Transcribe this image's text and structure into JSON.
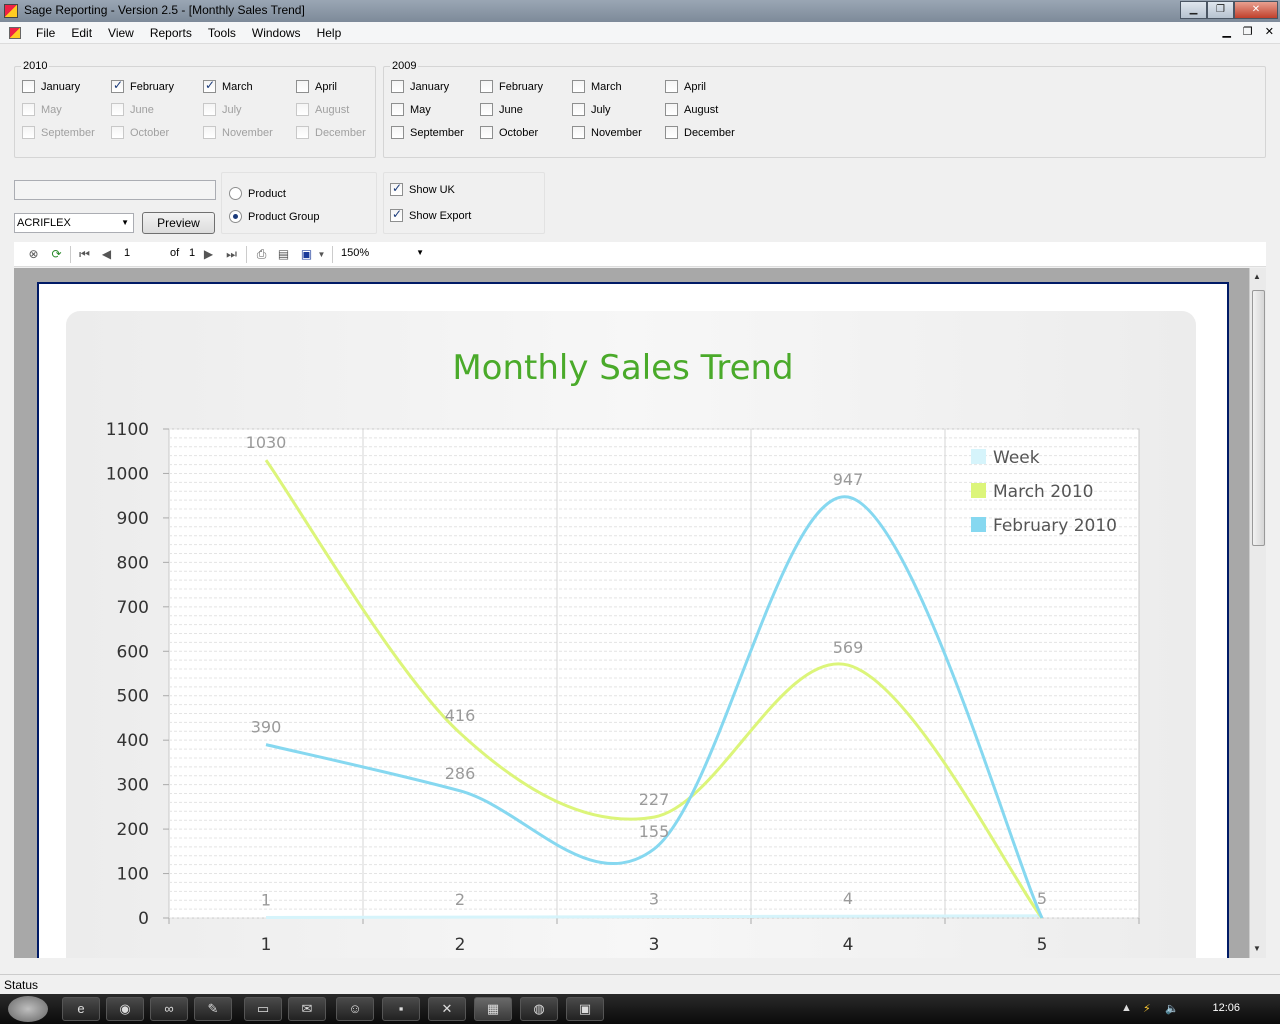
{
  "window": {
    "title": "Sage Reporting - Version 2.5 - [Monthly Sales Trend]"
  },
  "menu": [
    "File",
    "Edit",
    "View",
    "Reports",
    "Tools",
    "Windows",
    "Help"
  ],
  "year2010": {
    "label": "2010",
    "months": [
      {
        "label": "January",
        "checked": false,
        "disabled": false
      },
      {
        "label": "February",
        "checked": true,
        "disabled": false
      },
      {
        "label": "March",
        "checked": true,
        "disabled": false
      },
      {
        "label": "April",
        "checked": false,
        "disabled": false
      },
      {
        "label": "May",
        "checked": false,
        "disabled": true
      },
      {
        "label": "June",
        "checked": false,
        "disabled": true
      },
      {
        "label": "July",
        "checked": false,
        "disabled": true
      },
      {
        "label": "August",
        "checked": false,
        "disabled": true
      },
      {
        "label": "September",
        "checked": false,
        "disabled": true
      },
      {
        "label": "October",
        "checked": false,
        "disabled": true
      },
      {
        "label": "November",
        "checked": false,
        "disabled": true
      },
      {
        "label": "December",
        "checked": false,
        "disabled": true
      }
    ]
  },
  "year2009": {
    "label": "2009",
    "months": [
      {
        "label": "January",
        "checked": false,
        "disabled": false
      },
      {
        "label": "February",
        "checked": false,
        "disabled": false
      },
      {
        "label": "March",
        "checked": false,
        "disabled": false
      },
      {
        "label": "April",
        "checked": false,
        "disabled": false
      },
      {
        "label": "May",
        "checked": false,
        "disabled": false
      },
      {
        "label": "June",
        "checked": false,
        "disabled": false
      },
      {
        "label": "July",
        "checked": false,
        "disabled": false
      },
      {
        "label": "August",
        "checked": false,
        "disabled": false
      },
      {
        "label": "September",
        "checked": false,
        "disabled": false
      },
      {
        "label": "October",
        "checked": false,
        "disabled": false
      },
      {
        "label": "November",
        "checked": false,
        "disabled": false
      },
      {
        "label": "December",
        "checked": false,
        "disabled": false
      }
    ]
  },
  "filter": {
    "search_value": "",
    "combo_value": "ACRIFLEX",
    "preview_label": "Preview",
    "radio": [
      {
        "label": "Product",
        "selected": false
      },
      {
        "label": "Product Group",
        "selected": true
      }
    ],
    "show_uk": {
      "label": "Show UK",
      "checked": true
    },
    "show_export": {
      "label": "Show Export",
      "checked": true
    }
  },
  "toolbar": {
    "page": "1",
    "of_label": "of",
    "total_pages": "1",
    "zoom": "150%"
  },
  "chart_data": {
    "type": "line",
    "title": "Monthly Sales Trend",
    "title_color": "#4aaa2a",
    "categories": [
      1,
      2,
      3,
      4,
      5
    ],
    "ylim": [
      0,
      1100
    ],
    "yticks": [
      0,
      100,
      200,
      300,
      400,
      500,
      600,
      700,
      800,
      900,
      1000,
      1100
    ],
    "grid": true,
    "legend_position": "top-right",
    "series": [
      {
        "name": "Week",
        "color": "#d6f4fb",
        "values": [
          1,
          2,
          3,
          4,
          5
        ],
        "labels": [
          "1",
          "2",
          "3",
          "4",
          "5"
        ]
      },
      {
        "name": "March 2010",
        "color": "#dcf57a",
        "values": [
          1030,
          416,
          227,
          569,
          0
        ],
        "labels": [
          "1030",
          "416",
          "227",
          "569",
          ""
        ]
      },
      {
        "name": "February 2010",
        "color": "#86d8f0",
        "values": [
          390,
          286,
          155,
          947,
          0
        ],
        "labels": [
          "390",
          "286",
          "155",
          "947",
          ""
        ]
      }
    ]
  },
  "status": {
    "text": "Status"
  },
  "taskbar": {
    "clock": "12:06"
  }
}
